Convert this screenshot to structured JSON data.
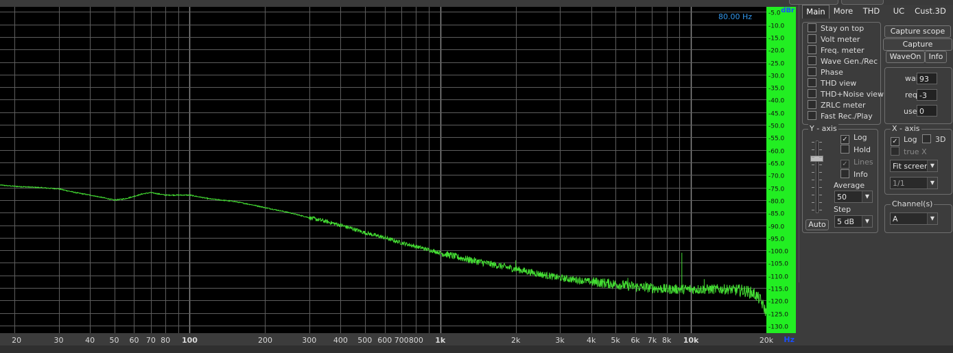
{
  "plot": {
    "freq_readout": "80.00 Hz",
    "y_unit": "dBr",
    "x_unit": "Hz"
  },
  "chart_data": {
    "type": "line",
    "x_scale": "log",
    "xlim": [
      17.5,
      20000
    ],
    "ylim": [
      -3,
      -133
    ],
    "x_ticks": [
      {
        "v": 20,
        "label": "20",
        "bold": false
      },
      {
        "v": 30,
        "label": "30",
        "bold": false
      },
      {
        "v": 40,
        "label": "40",
        "bold": false
      },
      {
        "v": 50,
        "label": "50",
        "bold": false
      },
      {
        "v": 60,
        "label": "60",
        "bold": false
      },
      {
        "v": 70,
        "label": "70",
        "bold": false
      },
      {
        "v": 80,
        "label": "80",
        "bold": false
      },
      {
        "v": 100,
        "label": "100",
        "bold": true
      },
      {
        "v": 200,
        "label": "200",
        "bold": false
      },
      {
        "v": 300,
        "label": "300",
        "bold": false
      },
      {
        "v": 400,
        "label": "400",
        "bold": false
      },
      {
        "v": 500,
        "label": "500",
        "bold": false
      },
      {
        "v": 600,
        "label": "600",
        "bold": false
      },
      {
        "v": 700,
        "label": "700",
        "bold": false
      },
      {
        "v": 800,
        "label": "800",
        "bold": false
      },
      {
        "v": 1000,
        "label": "1k",
        "bold": true
      },
      {
        "v": 2000,
        "label": "2k",
        "bold": false
      },
      {
        "v": 3000,
        "label": "3k",
        "bold": false
      },
      {
        "v": 4000,
        "label": "4k",
        "bold": false
      },
      {
        "v": 5000,
        "label": "5k",
        "bold": false
      },
      {
        "v": 6000,
        "label": "6k",
        "bold": false
      },
      {
        "v": 7000,
        "label": "7k",
        "bold": false
      },
      {
        "v": 8000,
        "label": "8k",
        "bold": false
      },
      {
        "v": 10000,
        "label": "10k",
        "bold": true
      },
      {
        "v": 20000,
        "label": "20k",
        "bold": false
      }
    ],
    "y_ticks": [
      -5,
      -10,
      -15,
      -20,
      -25,
      -30,
      -35,
      -40,
      -45,
      -50,
      -55,
      -60,
      -65,
      -70,
      -75,
      -80,
      -85,
      -90,
      -95,
      -100,
      -105,
      -110,
      -115,
      -120,
      -125,
      -130
    ],
    "y_tick_labels": [
      "-5.0",
      "-10.0",
      "-15.0",
      "-20.0",
      "-25.0",
      "-30.0",
      "-35.0",
      "-40.0",
      "-45.0",
      "-50.0",
      "-55.0",
      "-60.0",
      "-65.0",
      "-70.0",
      "-75.0",
      "-80.0",
      "-85.0",
      "-90.0",
      "-95.0",
      "-100.0",
      "-105.0",
      "-110.0",
      "-115.0",
      "-120.0",
      "-125.0",
      "-130.0"
    ],
    "series": [
      {
        "color": "#44dd33",
        "x": [
          17.5,
          20,
          25,
          30,
          35,
          40,
          45,
          50,
          55,
          60,
          65,
          70,
          80,
          90,
          100,
          120,
          150,
          180,
          200,
          250,
          300,
          350,
          400,
          450,
          500,
          600,
          700,
          800,
          1000,
          1200,
          1500,
          2000,
          2500,
          3000,
          4000,
          5000,
          6000,
          7000,
          8000,
          9000,
          10000,
          12000,
          14000,
          16000,
          17000,
          18000,
          19000,
          20000
        ],
        "y": [
          -74,
          -74.5,
          -75,
          -75.5,
          -77,
          -78,
          -79,
          -80,
          -79.5,
          -78.5,
          -77.5,
          -77,
          -78,
          -78,
          -78,
          -79.5,
          -80.5,
          -82,
          -83,
          -85,
          -87,
          -88.5,
          -90,
          -91.5,
          -93,
          -95,
          -97,
          -98.5,
          -101,
          -103,
          -105,
          -107.5,
          -109.5,
          -111,
          -112.5,
          -113.5,
          -114.5,
          -115,
          -115.5,
          -115.5,
          -115.5,
          -115.5,
          -115.5,
          -116,
          -116.5,
          -117.5,
          -120,
          -125
        ]
      }
    ],
    "spikes": [
      {
        "x": 9200,
        "y": -101
      },
      {
        "x": 11300,
        "y": -111.5
      },
      {
        "x": 5600,
        "y": -111
      },
      {
        "x": 2000,
        "y": -104
      },
      {
        "x": 6600,
        "y": -112.5
      }
    ]
  },
  "tabs": [
    "Main",
    "More",
    "THD",
    "UC",
    "Cust.3D"
  ],
  "main_checks": [
    {
      "label": "Stay on top",
      "checked": false
    },
    {
      "label": "Volt meter",
      "checked": false
    },
    {
      "label": "Freq. meter",
      "checked": false
    },
    {
      "label": "Wave Gen./Rec",
      "checked": false
    },
    {
      "label": "Phase",
      "checked": false
    },
    {
      "label": "THD view",
      "checked": false
    },
    {
      "label": "THD+Noise view",
      "checked": false
    },
    {
      "label": "ZRLC meter",
      "checked": false
    },
    {
      "label": "Fast Rec./Play",
      "checked": false
    }
  ],
  "buttons": {
    "capture_scope": "Capture scope",
    "capture_spectrum": "Capture spectrum",
    "waveon": "WaveOn",
    "info": "Info"
  },
  "stats": {
    "wait_label": "wait",
    "wait_value": "93",
    "req_label": "req.",
    "req_value": "-3",
    "used_label": "used",
    "used_value": "0"
  },
  "y_axis": {
    "title": "Y - axis",
    "log_label": "Log",
    "log_checked": true,
    "hold_label": "Hold",
    "hold_checked": false,
    "lines_label": "Lines",
    "lines_checked": true,
    "info_label": "Info",
    "info_checked": false,
    "average_label": "Average",
    "average_value": "50",
    "step_label": "Step",
    "step_value": "5 dB",
    "auto_label": "Auto"
  },
  "x_axis": {
    "title": "X - axis",
    "log_label": "Log",
    "log_checked": true,
    "threed_label": "3D",
    "threed_checked": false,
    "truex_label": "true X",
    "truex_checked": false,
    "fit_value": "Fit screen",
    "ratio_value": "1/1"
  },
  "channels": {
    "title": "Channel(s)",
    "value": "A"
  },
  "colors": {
    "plot_bg": "#000000",
    "grid": "#6e6e6e",
    "trace": "#44dd33",
    "scale_bar": "#22ee22",
    "axis_text": "#d8d8d8",
    "unit_text": "#1a4dff",
    "readout_text": "#3399ee"
  }
}
